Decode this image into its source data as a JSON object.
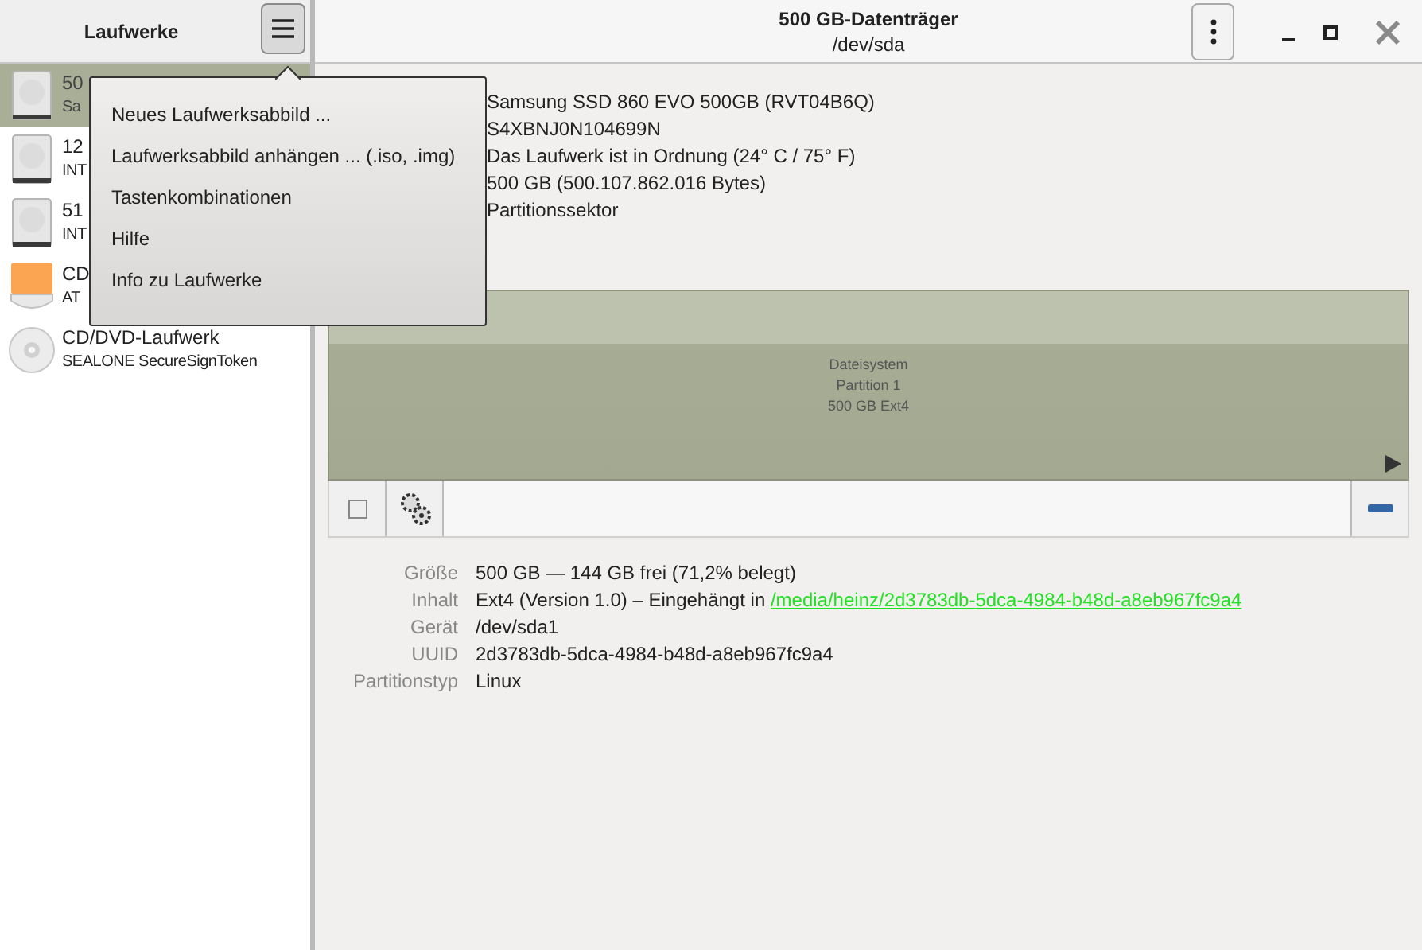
{
  "sidebar": {
    "title": "Laufwerke",
    "drives": [
      {
        "kind": "disk",
        "name": "50",
        "detail": "Sa",
        "selected": true
      },
      {
        "kind": "disk",
        "name": "12",
        "detail": "INT",
        "selected": false
      },
      {
        "kind": "disk",
        "name": "51",
        "detail": "INT",
        "selected": false
      },
      {
        "kind": "optical",
        "name": "CD",
        "detail": "AT",
        "selected": false
      },
      {
        "kind": "cd",
        "name": "CD/DVD-Laufwerk",
        "detail": "SEALONE SecureSignToken",
        "selected": false
      }
    ]
  },
  "menu": {
    "items": [
      "Neues Laufwerksabbild ...",
      "Laufwerksabbild anhängen ... (.iso, .img)",
      "Tastenkombinationen",
      "Hilfe",
      "Info zu Laufwerke"
    ]
  },
  "header": {
    "title": "500 GB-Datenträger",
    "subtitle": "/dev/sda"
  },
  "drive_info": [
    "Samsung SSD 860 EVO 500GB (RVT04B6Q)",
    "S4XBNJ0N104699N",
    "Das Laufwerk ist in Ordnung (24° C / 75° F)",
    "500 GB (500.107.862.016 Bytes)",
    "Partitionssektor"
  ],
  "partition": {
    "lines": [
      "Dateisystem",
      "Partition 1",
      "500 GB Ext4"
    ]
  },
  "properties": [
    {
      "label": "Größe",
      "value": "500 GB — 144 GB frei (71,2% belegt)"
    },
    {
      "label": "Inhalt",
      "value": "Ext4 (Version 1.0) – Eingehängt in ",
      "link": "/media/heinz/2d3783db-5dca-4984-b48d-a8eb967fc9a4"
    },
    {
      "label": "Gerät",
      "value": "/dev/sda1"
    },
    {
      "label": "UUID",
      "value": "2d3783db-5dca-4984-b48d-a8eb967fc9a4"
    },
    {
      "label": "Partitionstyp",
      "value": "Linux"
    }
  ]
}
